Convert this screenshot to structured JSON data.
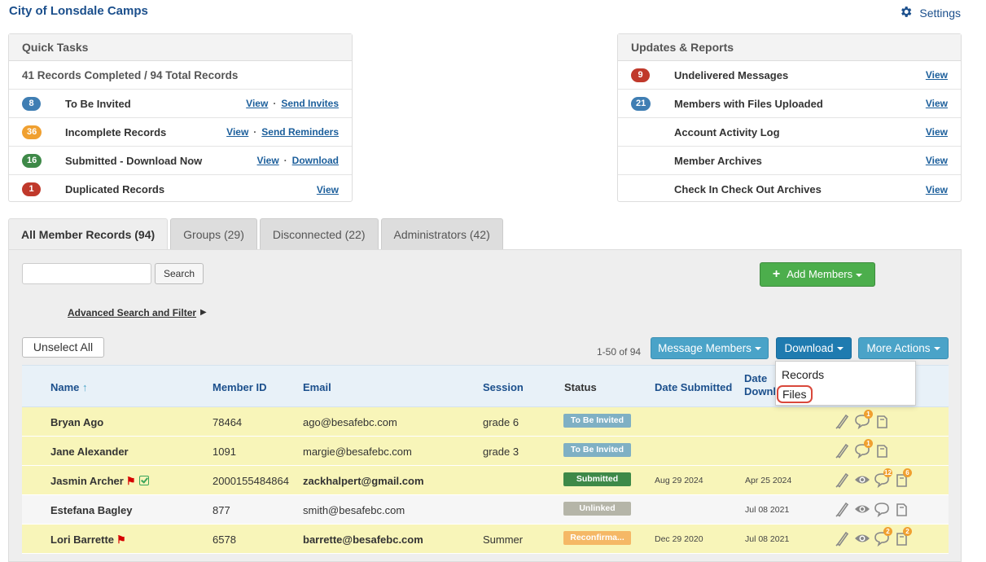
{
  "header": {
    "org_title": "City of Lonsdale Camps",
    "settings_label": "Settings"
  },
  "quick_tasks": {
    "title": "Quick Tasks",
    "summary": "41 Records Completed / 94 Total Records",
    "rows": [
      {
        "badge": "8",
        "color": "#3f7eb3",
        "label": "To Be Invited",
        "link1": "View",
        "link2": "Send Invites"
      },
      {
        "badge": "36",
        "color": "#f0a030",
        "label": "Incomplete Records",
        "link1": "View",
        "link2": "Send Reminders"
      },
      {
        "badge": "16",
        "color": "#3e8948",
        "label": "Submitted - Download Now",
        "link1": "View",
        "link2": "Download"
      },
      {
        "badge": "1",
        "color": "#c0392b",
        "label": "Duplicated Records",
        "link1": "View"
      }
    ]
  },
  "updates": {
    "title": "Updates & Reports",
    "rows": [
      {
        "badge": "9",
        "label": "Undelivered Messages",
        "link": "View"
      },
      {
        "badge": "21",
        "label": "Members with Files Uploaded",
        "link": "View"
      },
      {
        "label": "Account Activity Log",
        "link": "View"
      },
      {
        "label": "Member Archives",
        "link": "View"
      },
      {
        "label": "Check In Check Out Archives",
        "link": "View"
      }
    ]
  },
  "tabs": [
    "All Member Records (94)",
    "Groups (29)",
    "Disconnected (22)",
    "Administrators (42)"
  ],
  "toolbar": {
    "search_placeholder": "",
    "search_button": "Search",
    "add_members": "Add Members",
    "advanced_search": "Advanced Search and Filter",
    "unselect_all": "Unselect All",
    "count": "1-50 of 94",
    "message_members": "Message Members",
    "download": "Download",
    "more_actions": "More Actions"
  },
  "download_menu": {
    "records": "Records",
    "files": "Files"
  },
  "table": {
    "headers": {
      "name": "Name",
      "member_id": "Member ID",
      "email": "Email",
      "session": "Session",
      "status": "Status",
      "date_submitted": "Date Submitted",
      "date_downloaded_line1": "Date",
      "date_downloaded_line2": "Downl"
    },
    "rows": [
      {
        "name": "Bryan Ago",
        "member_id": "78464",
        "email": "ago@besafebc.com",
        "session": "grade 6",
        "status": "To Be Invited",
        "status_color": "#7fb0c4",
        "date_submitted": "",
        "date_downloaded": "",
        "flag": false,
        "check": false,
        "bold_email": false,
        "badge_comment": "1",
        "badge_file": ""
      },
      {
        "name": "Jane Alexander",
        "member_id": "1091",
        "email": "margie@besafebc.com",
        "session": "grade 3",
        "status": "To Be Invited",
        "status_color": "#7fb0c4",
        "date_submitted": "",
        "date_downloaded": "",
        "flag": false,
        "check": false,
        "bold_email": false,
        "badge_comment": "1",
        "badge_file": ""
      },
      {
        "name": "Jasmin Archer",
        "member_id": "2000155484864",
        "email": "zackhalpert@gmail.com",
        "session": "",
        "status": "Submitted",
        "status_color": "#3e8948",
        "date_submitted": "Aug 29 2024",
        "date_downloaded": "Apr 25 2024",
        "flag": true,
        "check": true,
        "bold_email": true,
        "badge_comment": "12",
        "badge_file": "6"
      },
      {
        "name": "Estefana Bagley",
        "member_id": "877",
        "email": "smith@besafebc.com",
        "session": "",
        "status": "Unlinked",
        "status_color": "#b5b5a8",
        "date_submitted": "",
        "date_downloaded": "Jul 08 2021",
        "flag": false,
        "check": false,
        "bold_email": false,
        "badge_comment": "",
        "badge_file": ""
      },
      {
        "name": "Lori Barrette",
        "member_id": "6578",
        "email": "barrette@besafebc.com",
        "session": "Summer",
        "status": "Reconfirma...",
        "status_color": "#f5b866",
        "date_submitted": "Dec 29 2020",
        "date_downloaded": "Jul 08 2021",
        "flag": true,
        "check": false,
        "bold_email": true,
        "badge_comment": "2",
        "badge_file": "2"
      }
    ]
  }
}
